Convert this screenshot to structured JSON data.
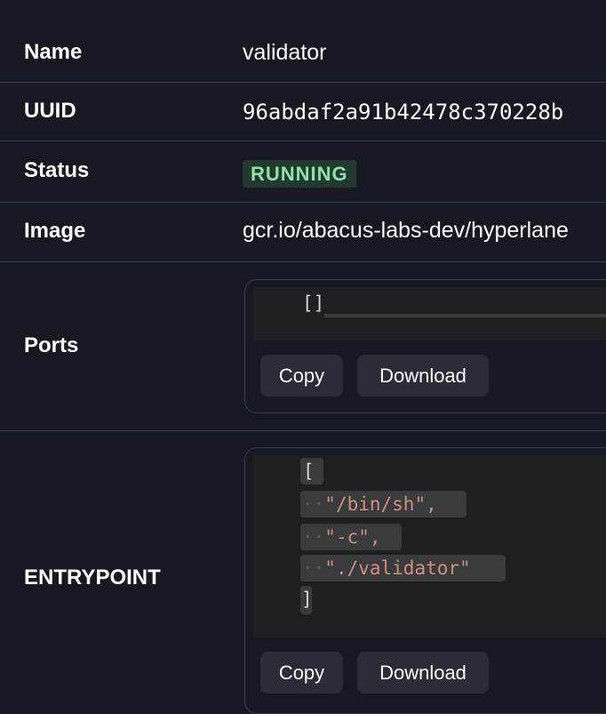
{
  "fields": {
    "name": {
      "label": "Name",
      "value": "validator"
    },
    "uuid": {
      "label": "UUID",
      "value": "96abdaf2a91b42478c370228b"
    },
    "status": {
      "label": "Status",
      "value": "RUNNING"
    },
    "image": {
      "label": "Image",
      "value": "gcr.io/abacus-labs-dev/hyperlane"
    },
    "ports": {
      "label": "Ports",
      "code": "[]",
      "copy_label": "Copy",
      "download_label": "Download"
    },
    "entrypoint": {
      "label": "ENTRYPOINT",
      "open": "[",
      "items": [
        "\"/bin/sh\",",
        "\"-c\",",
        "\"./validator\""
      ],
      "close": "]",
      "copy_label": "Copy",
      "download_label": "Download"
    }
  },
  "colors": {
    "background": "#171922",
    "badge_bg": "#22392f",
    "badge_text": "#8fe0a6",
    "string": "#ce9178"
  }
}
